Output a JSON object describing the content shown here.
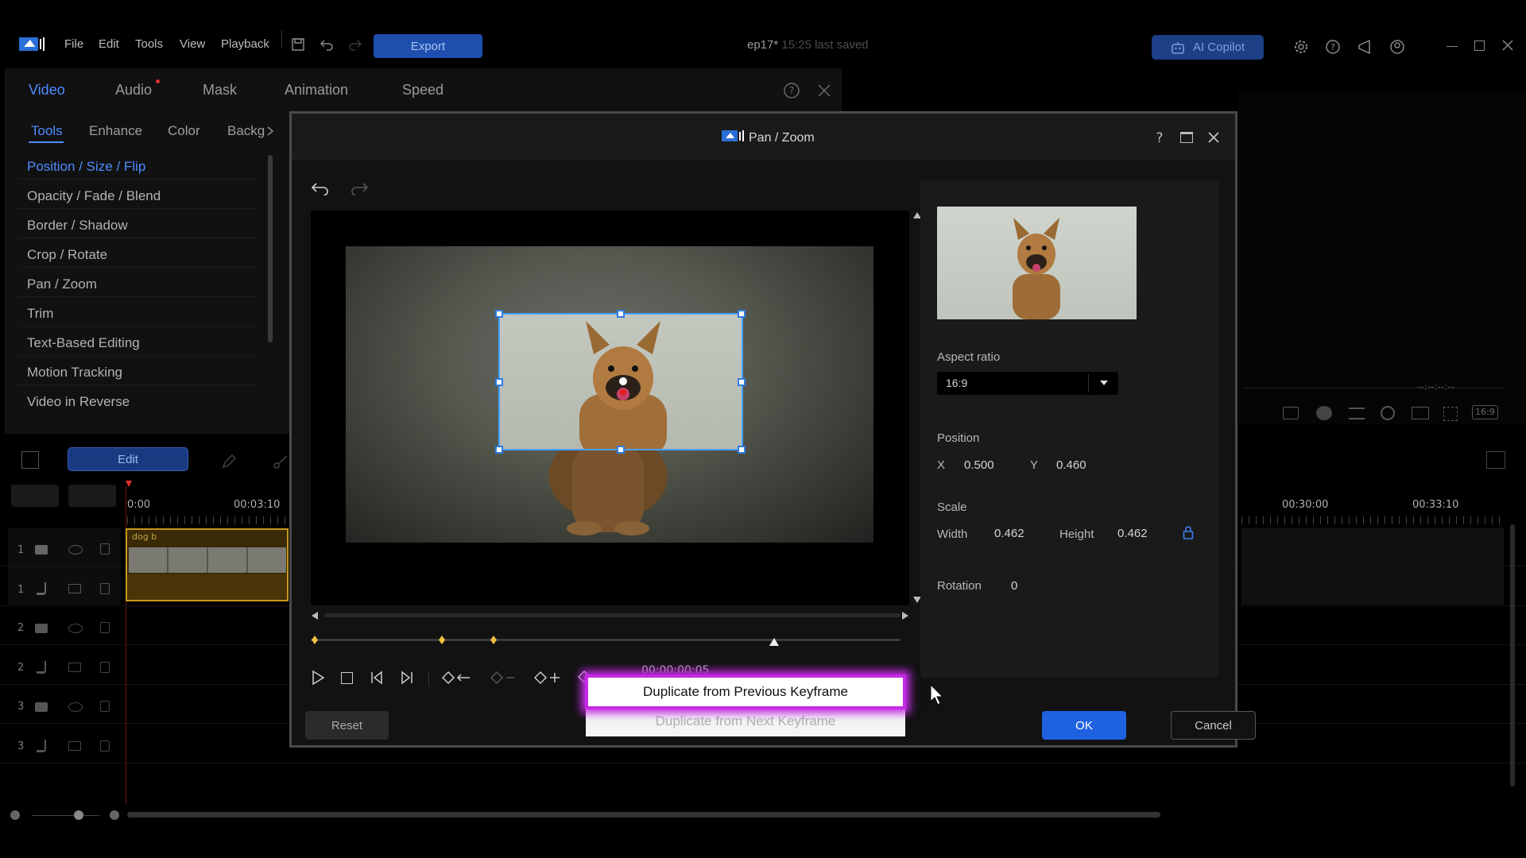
{
  "menubar": {
    "items": [
      "File",
      "Edit",
      "Tools",
      "View",
      "Playback"
    ],
    "export_label": "Export",
    "title": "ep17*",
    "saved_text": "15:25 last saved",
    "ai_label": "AI Copilot"
  },
  "panel": {
    "tabs": [
      "Video",
      "Audio",
      "Mask",
      "Animation",
      "Speed"
    ],
    "subtabs": [
      "Tools",
      "Enhance",
      "Color",
      "Backg"
    ],
    "tools": [
      "Position / Size / Flip",
      "Opacity / Fade / Blend",
      "Border / Shadow",
      "Crop / Rotate",
      "Pan / Zoom",
      "Trim",
      "Text-Based Editing",
      "Motion Tracking",
      "Video in Reverse"
    ]
  },
  "timeline": {
    "edit_label": "Edit",
    "times": [
      "0:00",
      "00:03:10",
      "00:30:00",
      "00:33:10"
    ],
    "track_numbers": [
      "1",
      "1",
      "2",
      "2",
      "3",
      "3"
    ],
    "clip_name": "dog b",
    "preview_time": "--:--:--:--",
    "aspect_badge": "16:9"
  },
  "dialog": {
    "title": "Pan / Zoom",
    "aspect_label": "Aspect ratio",
    "aspect_value": "16:9",
    "position_label": "Position",
    "x_label": "X",
    "x_value": "0.500",
    "y_label": "Y",
    "y_value": "0.460",
    "scale_label": "Scale",
    "width_label": "Width",
    "width_value": "0.462",
    "height_label": "Height",
    "height_value": "0.462",
    "rotation_label": "Rotation",
    "rotation_value": "0",
    "timecode": "00:00:00:05",
    "reset_label": "Reset",
    "ok_label": "OK",
    "cancel_label": "Cancel"
  },
  "context_menu": {
    "items": [
      "Duplicate from Previous Keyframe",
      "Duplicate from Next Keyframe"
    ]
  },
  "colors": {
    "accent": "#1f62e0",
    "highlight": "#c42ae6",
    "keyframe": "#f0c040"
  }
}
